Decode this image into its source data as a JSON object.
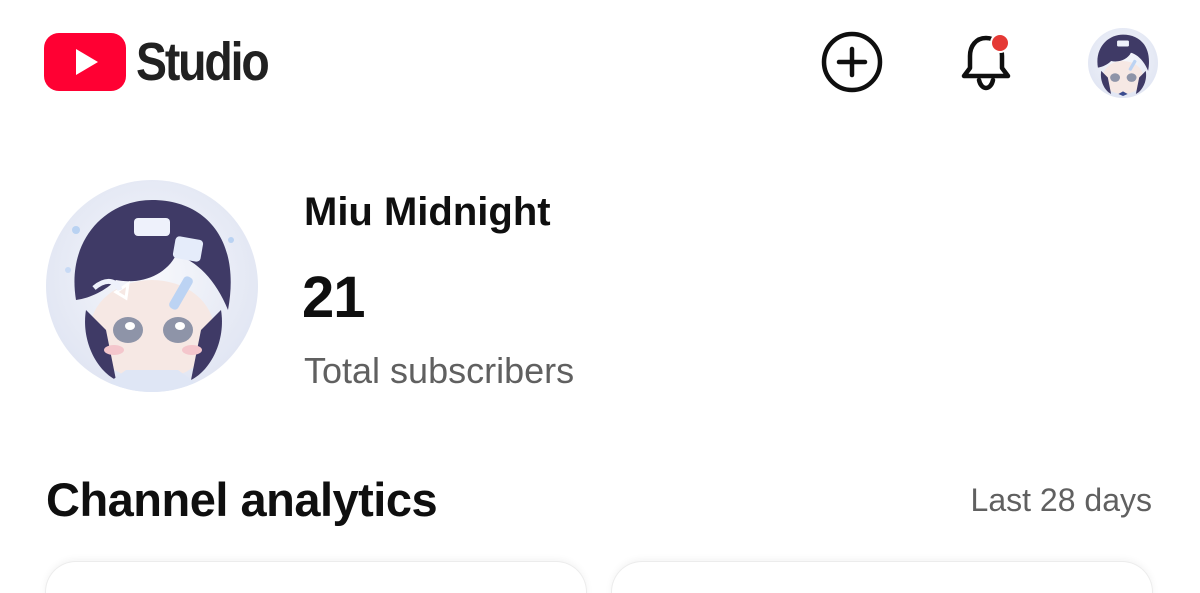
{
  "header": {
    "logo_text": "Studio",
    "create_icon": "add-circle-icon",
    "notification_icon": "bell-icon",
    "notification_dot_color": "#e53935",
    "account_icon": "avatar"
  },
  "channel": {
    "name": "Miu Midnight",
    "subscriber_count": "21",
    "subscriber_label": "Total subscribers"
  },
  "analytics": {
    "title": "Channel analytics",
    "range": "Last 28 days"
  },
  "colors": {
    "brand_red": "#ff0000",
    "text_primary": "#0f0f0f",
    "text_secondary": "#606060"
  }
}
